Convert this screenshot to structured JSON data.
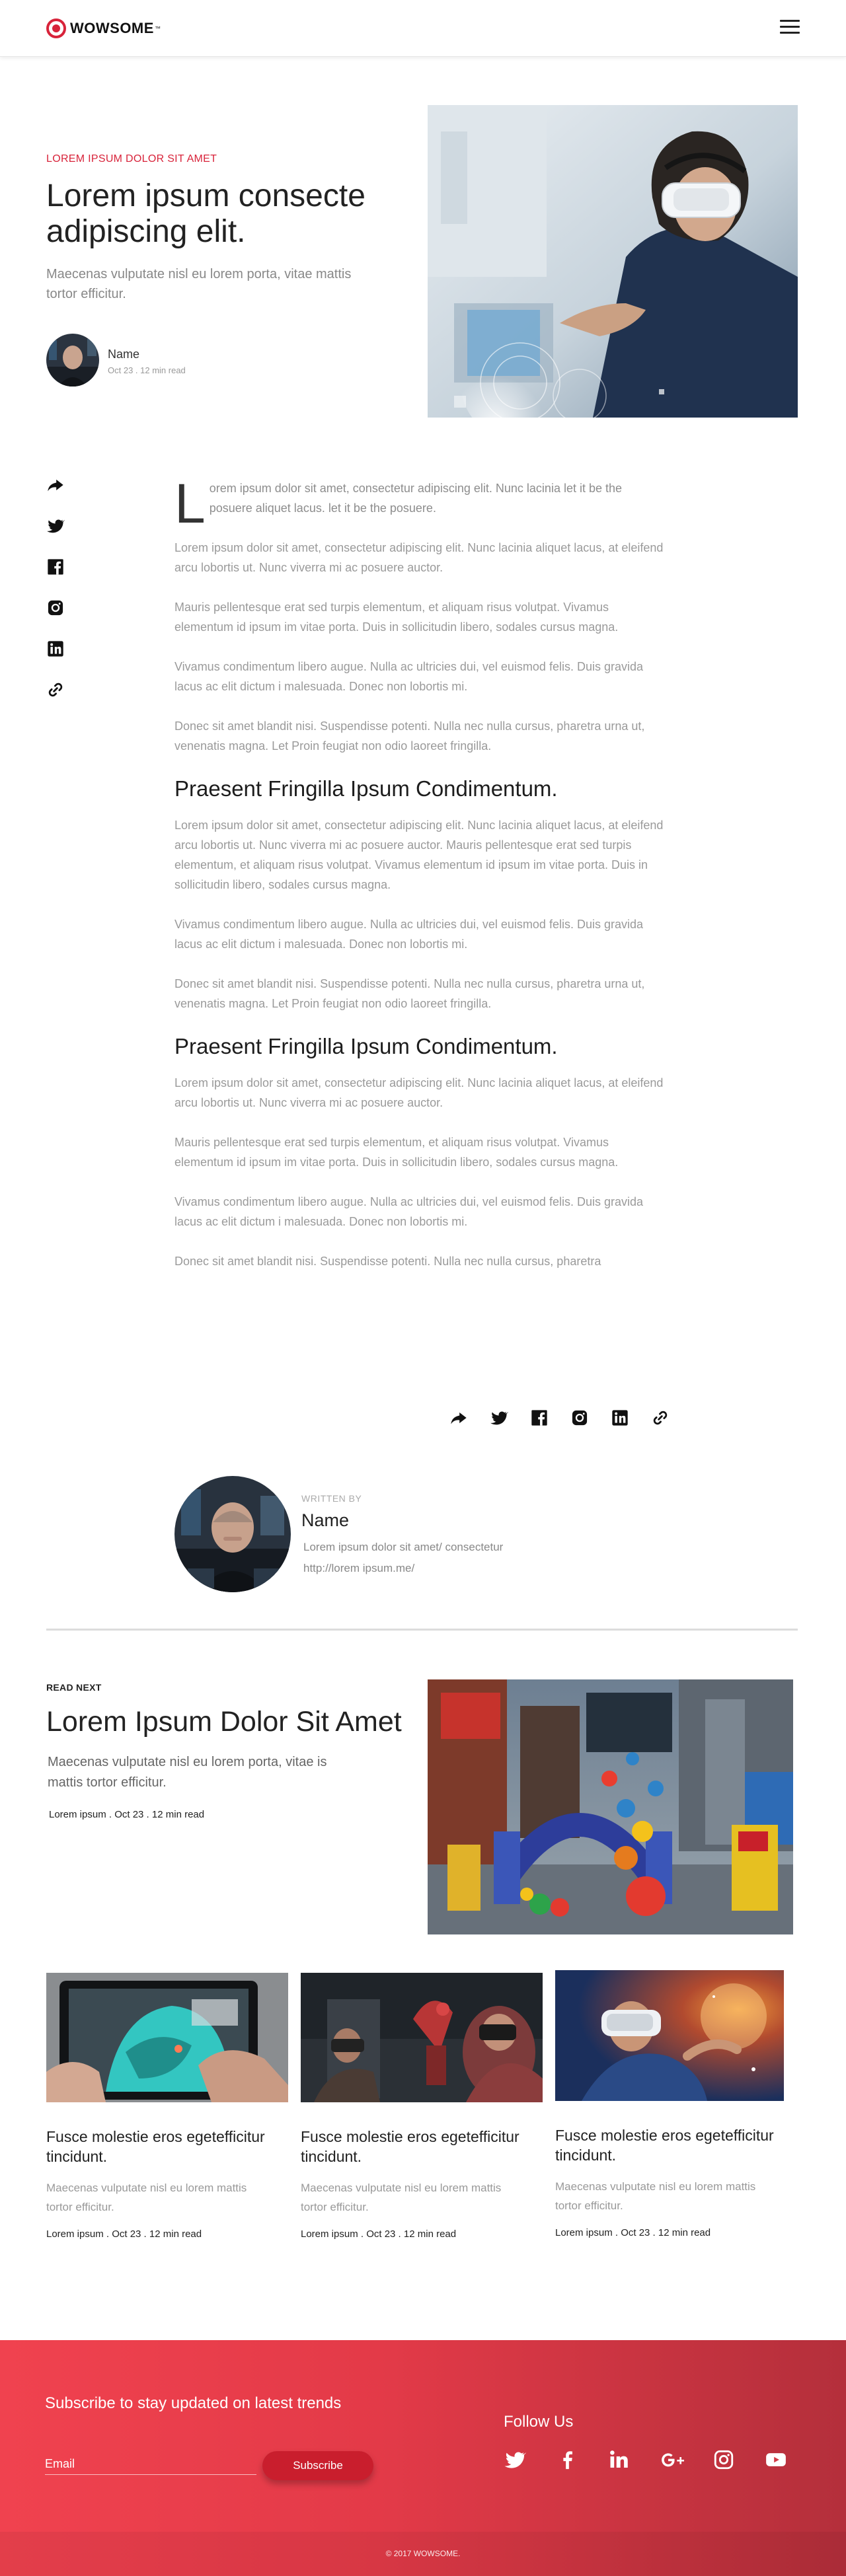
{
  "header": {
    "logo_text": "WOWSOME",
    "logo_trademark": "™",
    "menu_icon": "hamburger-icon",
    "brand_color": "#d8233a"
  },
  "hero": {
    "eyebrow": "LOREM IPSUM DOLOR SIT AMET",
    "title": "Lorem ipsum consecte adipiscing elit.",
    "subtitle": "Maecenas vulputate nisl eu lorem porta, vitae mattis tortor efficitur.",
    "author": {
      "name": "Name",
      "meta": "Oct 23 . 12 min read"
    },
    "image": "vr-headset-woman-photo"
  },
  "share": {
    "icons": [
      "share-icon",
      "twitter-icon",
      "facebook-icon",
      "instagram-icon",
      "linkedin-icon",
      "link-icon"
    ]
  },
  "article": {
    "dropcap": "L",
    "intro": "orem ipsum dolor sit amet, consectetur adipiscing elit. Nunc lacinia  let it be the posuere aliquet lacus. let it be the posuere.",
    "paragraphs_a": [
      "Lorem ipsum dolor sit amet, consectetur adipiscing elit. Nunc lacinia aliquet lacus, at eleifend arcu lobortis ut. Nunc viverra mi ac posuere auctor.",
      "Mauris pellentesque erat sed turpis elementum, et aliquam risus volutpat. Vivamus elementum id ipsum im vitae porta. Duis in sollicitudin libero, sodales cursus magna.",
      "Vivamus condimentum libero augue. Nulla ac ultricies dui, vel euismod felis. Duis gravida lacus ac elit dictum i malesuada. Donec non lobortis mi.",
      "Donec sit amet blandit nisi. Suspendisse potenti. Nulla nec nulla cursus, pharetra urna ut, venenatis magna. Let Proin feugiat non odio laoreet fringilla."
    ],
    "section_1": {
      "title": "Praesent Fringilla Ipsum Condimentum.",
      "paragraphs": [
        "Lorem ipsum dolor sit amet, consectetur adipiscing elit. Nunc lacinia aliquet lacus, at eleifend arcu lobortis ut. Nunc viverra mi ac posuere auctor. Mauris pellentesque erat sed turpis elementum, et aliquam risus volutpat. Vivamus elementum id ipsum im vitae porta. Duis in sollicitudin libero, sodales cursus magna.",
        "Vivamus condimentum libero augue. Nulla ac ultricies dui, vel euismod felis. Duis gravida lacus ac elit dictum i malesuada. Donec non lobortis mi.",
        "Donec sit amet blandit nisi. Suspendisse potenti. Nulla nec nulla cursus, pharetra urna ut, venenatis magna. Let Proin feugiat non odio laoreet fringilla."
      ]
    },
    "section_2": {
      "title": "Praesent Fringilla Ipsum Condimentum.",
      "paragraphs": [
        "Lorem ipsum dolor sit amet, consectetur adipiscing elit. Nunc lacinia aliquet lacus, at eleifend arcu lobortis ut. Nunc viverra mi ac posuere auctor.",
        "Mauris pellentesque erat sed turpis elementum, et aliquam risus volutpat. Vivamus elementum id ipsum im vitae porta. Duis in sollicitudin libero, sodales cursus magna.",
        "Vivamus condimentum libero augue. Nulla ac ultricies dui, vel euismod felis. Duis gravida lacus ac elit dictum i malesuada. Donec non lobortis mi.",
        "Donec sit amet blandit nisi. Suspendisse potenti. Nulla nec nulla cursus, pharetra"
      ]
    }
  },
  "author_card": {
    "written_by": "WRITTEN BY",
    "name": "Name",
    "bio": "Lorem ipsum dolor sit amet/ consectetur",
    "url": "http://lorem ipsum.me/"
  },
  "read_next": {
    "label": "READ NEXT",
    "title": "Lorem Ipsum Dolor Sit Amet",
    "subtitle": "Maecenas vulputate nisl eu lorem porta, vitae is mattis tortor efficitur.",
    "meta": "Lorem ipsum . Oct 23 . 12 min read",
    "image": "times-square-mms-photo"
  },
  "cards": [
    {
      "title": "Fusce molestie eros egetefficitur tincidunt.",
      "subtitle": "Maecenas vulputate nisl eu lorem mattis tortor efficitur.",
      "meta": "Lorem ipsum . Oct 23 . 12 min read",
      "image": "tablet-ar-photo"
    },
    {
      "title": "Fusce molestie eros egetefficitur tincidunt.",
      "subtitle": "Maecenas vulputate nisl eu lorem mattis tortor efficitur.",
      "meta": "Lorem ipsum . Oct 23 . 12 min read",
      "image": "vr-robot-arm-photo"
    },
    {
      "title": "Fusce molestie eros egetefficitur tincidunt.",
      "subtitle": "Maecenas vulputate nisl eu lorem mattis tortor efficitur.",
      "meta": "Lorem ipsum . Oct 23 . 12 min read",
      "image": "vr-space-man-photo"
    }
  ],
  "footer": {
    "subscribe_title": "Subscribe to stay updated on latest trends",
    "email_label": "Email",
    "subscribe_button": "Subscribe",
    "follow_title": "Follow Us",
    "social_icons": [
      "twitter-icon",
      "facebook-icon",
      "linkedin-icon",
      "google-plus-icon",
      "instagram-icon",
      "youtube-icon"
    ],
    "copyright": "© 2017 WOWSOME.",
    "gradient_start": "#f0424f",
    "gradient_end": "#b42f3b"
  }
}
